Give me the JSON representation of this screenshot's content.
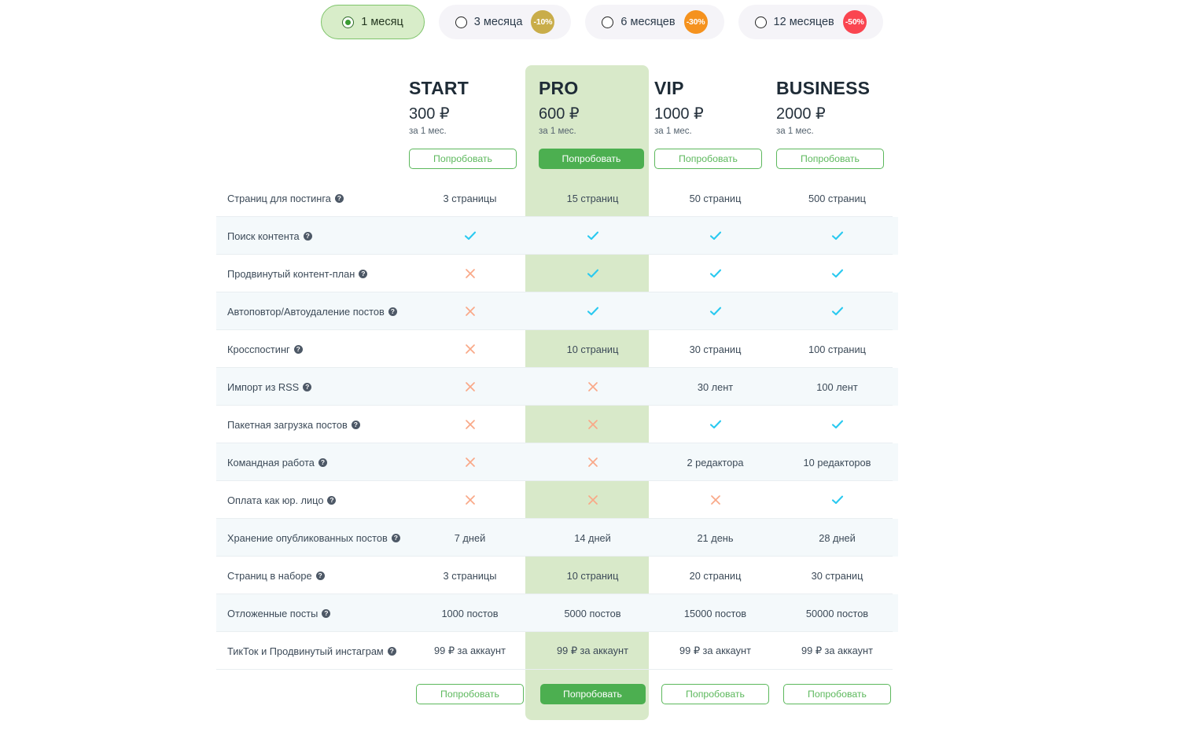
{
  "period_selector": {
    "options": [
      {
        "label": "1 месяц",
        "selected": true,
        "discount": null,
        "discount_color": null
      },
      {
        "label": "3 месяца",
        "selected": false,
        "discount": "-10%",
        "discount_color": "#c9ad4a"
      },
      {
        "label": "6 месяцев",
        "selected": false,
        "discount": "-30%",
        "discount_color": "#f5921e"
      },
      {
        "label": "12 месяцев",
        "selected": false,
        "discount": "-50%",
        "discount_color": "#fa4550"
      }
    ]
  },
  "plans": [
    {
      "name": "START",
      "price": "300 ₽",
      "period": "за 1 мес.",
      "cta": "Попробовать",
      "highlight": false
    },
    {
      "name": "PRO",
      "price": "600 ₽",
      "period": "за 1 мес.",
      "cta": "Попробовать",
      "highlight": true
    },
    {
      "name": "VIP",
      "price": "1000 ₽",
      "period": "за 1 мес.",
      "cta": "Попробовать",
      "highlight": false
    },
    {
      "name": "BUSINESS",
      "price": "2000 ₽",
      "period": "за 1 мес.",
      "cta": "Попробовать",
      "highlight": false
    }
  ],
  "help_glyph": "?",
  "icons": {
    "check": "check-icon",
    "cross": "cross-icon",
    "help": "help-icon",
    "radio": "radio-icon"
  },
  "colors": {
    "accent_green": "#4caf50",
    "highlight_bg": "#d8e9c9",
    "stripe_bg": "#f4f9fb",
    "check": "#29c9f0",
    "cross": "#f9a887",
    "pill_bg": "#f5f4f8",
    "pill_active_bg": "#d8edc9"
  },
  "features": [
    {
      "label": "Страниц для постинга",
      "values": [
        "3 страницы",
        "15 страниц",
        "50 страниц",
        "500 страниц"
      ]
    },
    {
      "label": "Поиск контента",
      "values": [
        "check",
        "check",
        "check",
        "check"
      ]
    },
    {
      "label": "Продвинутый контент-план",
      "values": [
        "cross",
        "check",
        "check",
        "check"
      ]
    },
    {
      "label": "Автоповтор/Автоудаление постов",
      "values": [
        "cross",
        "check",
        "check",
        "check"
      ]
    },
    {
      "label": "Кросспостинг",
      "values": [
        "cross",
        "10 страниц",
        "30 страниц",
        "100 страниц"
      ]
    },
    {
      "label": "Импорт из RSS",
      "values": [
        "cross",
        "cross",
        "30 лент",
        "100 лент"
      ]
    },
    {
      "label": "Пакетная загрузка постов",
      "values": [
        "cross",
        "cross",
        "check",
        "check"
      ]
    },
    {
      "label": "Командная работа",
      "values": [
        "cross",
        "cross",
        "2 редактора",
        "10 редакторов"
      ]
    },
    {
      "label": "Оплата как юр. лицо",
      "values": [
        "cross",
        "cross",
        "cross",
        "check"
      ]
    },
    {
      "label": "Хранение опубликованных постов",
      "values": [
        "7 дней",
        "14 дней",
        "21 день",
        "28 дней"
      ]
    },
    {
      "label": "Страниц в наборе",
      "values": [
        "3 страницы",
        "10 страниц",
        "20 страниц",
        "30 страниц"
      ]
    },
    {
      "label": "Отложенные посты",
      "values": [
        "1000 постов",
        "5000 постов",
        "15000 постов",
        "50000 постов"
      ]
    },
    {
      "label": "ТикТок и Продвинутый инстаграм",
      "values": [
        "99 ₽ за аккаунт",
        "99 ₽ за аккаунт",
        "99 ₽ за аккаунт",
        "99 ₽ за аккаунт"
      ]
    }
  ]
}
